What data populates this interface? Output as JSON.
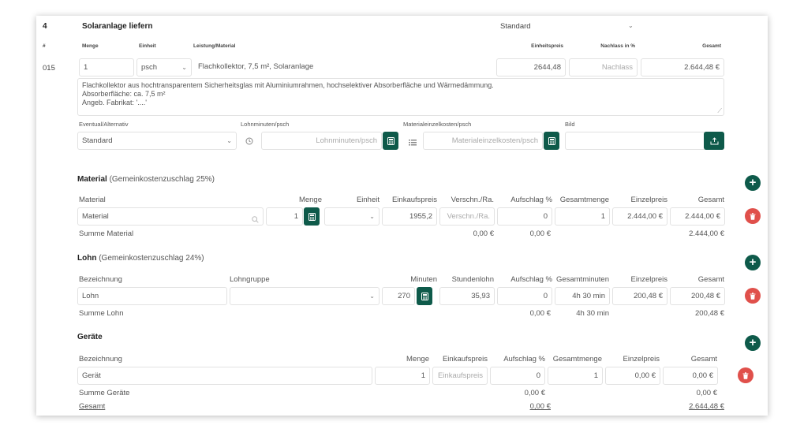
{
  "header": {
    "pos_number": "4",
    "title": "Solaranlage liefern",
    "variant": "Standard"
  },
  "columns": {
    "hash": "#",
    "menge": "Menge",
    "einheit": "Einheit",
    "leistung": "Leistung/Material",
    "einheitspreis": "Einheitspreis",
    "nachlass": "Nachlass in %",
    "gesamt": "Gesamt"
  },
  "item": {
    "number": "015",
    "menge": "1",
    "einheit": "psch",
    "leistung": "Flachkollektor, 7,5 m², Solaranlage",
    "einheitspreis": "2644,48",
    "nachlass_placeholder": "Nachlass",
    "gesamt": "2.644,48 €",
    "description_line1": "Flachkollektor aus hochtransparentem Sicherheitsglas mit Aluminiumrahmen, hochselektiver Absorberfläche und Wärmedämmung.",
    "description_line2": "Absorberfläche: ca. 7,5 m²",
    "description_line3": "Angeb. Fabrikat: '....'"
  },
  "options": {
    "eventual_label": "Eventual/Alternativ",
    "eventual_value": "Standard",
    "lohnminuten_label": "Lohnminuten/psch",
    "lohnminuten_placeholder": "Lohnminuten/psch",
    "materialkosten_label": "Materialeinzelkosten/psch",
    "materialkosten_placeholder": "Materialeinzelkosten/psch",
    "bild_label": "Bild"
  },
  "material": {
    "title": "Material",
    "subtitle": "(Gemeinkostenzuschlag 25%)",
    "cols": {
      "material": "Material",
      "menge": "Menge",
      "einheit": "Einheit",
      "einkaufspreis": "Einkaufspreis",
      "verschn": "Verschn./Ra.",
      "aufschlag": "Aufschlag %",
      "gesamtmenge": "Gesamtmenge",
      "einzelpreis": "Einzelpreis",
      "gesamt": "Gesamt"
    },
    "row": {
      "material": "Material",
      "menge": "1",
      "einkaufspreis": "1955,2",
      "verschn_placeholder": "Verschn./Ra.",
      "aufschlag": "0",
      "gesamtmenge": "1",
      "einzelpreis": "2.444,00 €",
      "gesamt": "2.444,00 €"
    },
    "summe_label": "Summe Material",
    "summe_verschn": "0,00 €",
    "summe_aufschlag": "0,00 €",
    "summe_gesamt": "2.444,00 €"
  },
  "lohn": {
    "title": "Lohn",
    "subtitle": "(Gemeinkostenzuschlag 24%)",
    "cols": {
      "bezeichnung": "Bezeichnung",
      "lohngruppe": "Lohngruppe",
      "minuten": "Minuten",
      "stundenlohn": "Stundenlohn",
      "aufschlag": "Aufschlag %",
      "gesamtminuten": "Gesamtminuten",
      "einzelpreis": "Einzelpreis",
      "gesamt": "Gesamt"
    },
    "row": {
      "bezeichnung": "Lohn",
      "minuten": "270",
      "stundenlohn": "35,93",
      "aufschlag": "0",
      "gesamtminuten": "4h 30 min",
      "einzelpreis": "200,48 €",
      "gesamt": "200,48 €"
    },
    "summe_label": "Summe Lohn",
    "summe_aufschlag": "0,00 €",
    "summe_minuten": "4h 30 min",
    "summe_gesamt": "200,48 €"
  },
  "geraete": {
    "title": "Geräte",
    "cols": {
      "bezeichnung": "Bezeichnung",
      "menge": "Menge",
      "einkaufspreis": "Einkaufspreis",
      "aufschlag": "Aufschlag %",
      "gesamtmenge": "Gesamtmenge",
      "einzelpreis": "Einzelpreis",
      "gesamt": "Gesamt"
    },
    "row": {
      "bezeichnung": "Gerät",
      "menge": "1",
      "einkaufspreis_placeholder": "Einkaufspreis",
      "aufschlag": "0",
      "gesamtmenge": "1",
      "einzelpreis": "0,00 €",
      "gesamt": "0,00 €"
    },
    "summe_label": "Summe Geräte",
    "summe_aufschlag": "0,00 €",
    "summe_gesamt": "0,00 €"
  },
  "total": {
    "label": "Gesamt",
    "aufschlag": "0,00 €",
    "gesamt": "2.644,48 €"
  },
  "colors": {
    "accent": "#0e5a4a",
    "delete": "#e0504b"
  }
}
